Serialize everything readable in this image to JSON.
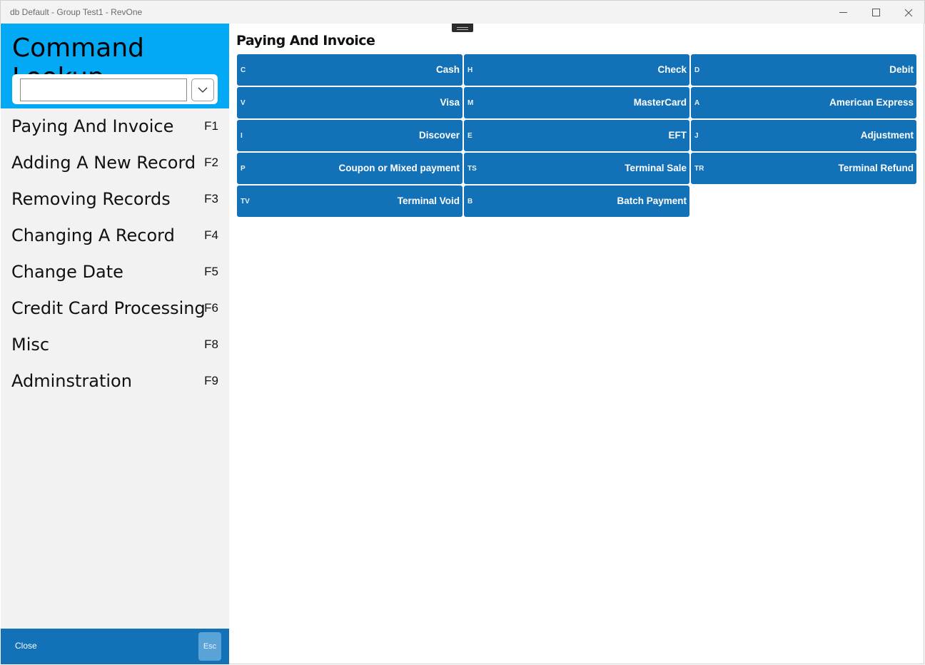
{
  "window": {
    "title": "db Default - Group Test1 - RevOne",
    "icons": [
      "minimize-icon",
      "maximize-icon",
      "close-icon"
    ]
  },
  "sidebar": {
    "title": "Command Lookup",
    "search": {
      "value": "",
      "placeholder": ""
    },
    "items": [
      {
        "label": "Paying And Invoice",
        "key": "F1"
      },
      {
        "label": "Adding A New Record",
        "key": "F2"
      },
      {
        "label": "Removing Records",
        "key": "F3"
      },
      {
        "label": "Changing A Record",
        "key": "F4"
      },
      {
        "label": "Change Date",
        "key": "F5"
      },
      {
        "label": "Credit Card Processing",
        "key": "F6"
      },
      {
        "label": "Misc",
        "key": "F8"
      },
      {
        "label": "Adminstration",
        "key": "F9"
      }
    ],
    "footer": {
      "close_label": "Close",
      "esc_label": "Esc"
    }
  },
  "main": {
    "section_title": "Paying And Invoice",
    "commands": [
      {
        "key": "C",
        "label": "Cash"
      },
      {
        "key": "H",
        "label": "Check"
      },
      {
        "key": "D",
        "label": "Debit"
      },
      {
        "key": "V",
        "label": "Visa"
      },
      {
        "key": "M",
        "label": "MasterCard"
      },
      {
        "key": "A",
        "label": "American Express"
      },
      {
        "key": "I",
        "label": "Discover"
      },
      {
        "key": "E",
        "label": "EFT"
      },
      {
        "key": "J",
        "label": "Adjustment"
      },
      {
        "key": "P",
        "label": "Coupon or Mixed payment"
      },
      {
        "key": "TS",
        "label": "Terminal Sale"
      },
      {
        "key": "TR",
        "label": "Terminal Refund"
      },
      {
        "key": "TV",
        "label": "Terminal Void"
      },
      {
        "key": "B",
        "label": "Batch Payment"
      }
    ]
  },
  "colors": {
    "header_blue": "#03a9f4",
    "button_blue": "#1371b8",
    "sidebar_bg": "#f2f2f2"
  }
}
